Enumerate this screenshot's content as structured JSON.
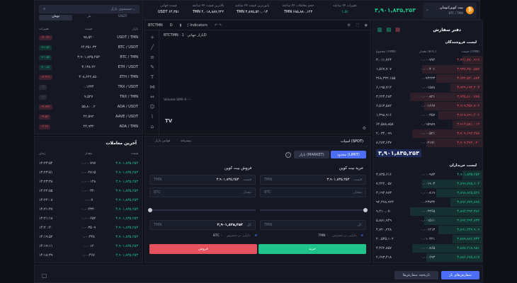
{
  "colors": {
    "green": "#1ec48b",
    "red": "#e8525e",
    "accent": "#4c6ef5",
    "orange": "#f7931a"
  },
  "market": {
    "pair_name": "بیت کوین/تومان",
    "pair_sub": "BTC / TMN",
    "last_price": "۳,۹۰۱,۸۳۵,۲۵۳",
    "change_label": "تغییرات ۲۴ ساعته",
    "change_value": "۱.۵٪",
    "high_label": "بالاترین قیمت ۲۴ ساعته",
    "high_value": "TMN ۴,۰۱۸,۸۸۷,۲۲۲",
    "low_label": "پایین‌ترین قیمت ۲۴ ساعته",
    "low_value": "TMN ۳,۸۷۵,۵۲۰,۰۱۴",
    "vol_label": "حجم معاملات ۲۴ ساعته",
    "vol_value": "TMN ۶۸۵,۸۸۰,۱۲۳",
    "usdt_label": "قیمت جهانی",
    "usdt_value": "USDT ۶۴,۳۵۱"
  },
  "search": {
    "placeholder": "جستجوی بازار..."
  },
  "market_tabs": [
    "تومان",
    "تتر",
    "USDT"
  ],
  "market_list": {
    "headers": [
      "تغییرات",
      "قیمت",
      "بازار"
    ],
    "rows": [
      {
        "change": "-۲.۰۴٪",
        "price": "۹۸,۵۲۰",
        "pair": "USDT / TMN",
        "dir": "down"
      },
      {
        "change": "+۱.۵٪",
        "price": "۶۴,۳۵۱.۳۳",
        "pair": "BTC / USDT",
        "dir": "up"
      },
      {
        "change": "+۱.۵٪",
        "price": "۳,۹۰۱,۸۳۵,۲۵۳",
        "pair": "BTC / TMN",
        "dir": "up"
      },
      {
        "change": "+۰.۸٪",
        "price": "۳,۱۳۸.۲۲",
        "pair": "ETH / USDT",
        "dir": "up"
      },
      {
        "change": "-۲.۹۱٪",
        "price": "۳۰۸,۶۲۲,۸۵۰",
        "pair": "ETH / TMN",
        "dir": "down"
      },
      {
        "change": "۰٪",
        "price": "۰.۱۲۳۴",
        "pair": "TRX / USDT",
        "dir": "flat"
      },
      {
        "change": "۰٪",
        "price": "۷,۵۲۷",
        "pair": "TRX / TMN",
        "dir": "flat"
      },
      {
        "change": "-۲.۸۹٪",
        "price": "۵۵,۸۰۰.۲",
        "pair": "ADA / USDT",
        "dir": "down"
      },
      {
        "change": "-۴.۵٪",
        "price": "۲۲,۵۹۲",
        "pair": "AAVE / USDT",
        "dir": "down"
      },
      {
        "change": "-۳.۳٪",
        "price": "۲۳,۹۳۲",
        "pair": "ADA / TMN",
        "dir": "down"
      }
    ]
  },
  "trades": {
    "title": "آخرین معاملات",
    "headers": [
      "زمان",
      "مقدار",
      "قیمت"
    ],
    "rows": [
      {
        "time": "۱۴:۲۳:۵۴",
        "amount": "۰.۰۰۰۷۹۷",
        "price": "۳,۹۰۱,۸۳۵,۲۵۳",
        "dir": "up"
      },
      {
        "time": "۱۴:۲۳:۵۱",
        "amount": "۰.۰۰۲۸۱۵",
        "price": "۳,۹۰۱,۸۳۵,۲۵۳",
        "dir": "up"
      },
      {
        "time": "۱۴:۲۳:۳۸",
        "amount": "۰.۰۰۰۱۴۸",
        "price": "۳,۹۰۱,۸۳۵,۲۵۳",
        "dir": "up"
      },
      {
        "time": "۱۴:۲۲:۵۵",
        "amount": "۰.۰۰۰۳۲۰",
        "price": "۳,۹۰۱,۸۳۵,۲۵۳",
        "dir": "up"
      },
      {
        "time": "۱۴:۲۲:۰۸",
        "amount": "۰.۰۰۷",
        "price": "۳,۹۰۱,۸۳۵,۲۵۳",
        "dir": "up"
      },
      {
        "time": "۱۴:۲۱:۴۷",
        "amount": "۰.۰۰۴۳۳۰",
        "price": "۳,۹۰۱,۸۳۵,۲۵۳",
        "dir": "up"
      },
      {
        "time": "۱۴:۲۱:۱۸",
        "amount": "۰.۰۰۰۶۵۲",
        "price": "۳,۹۰۱,۸۳۵,۲۵۳",
        "dir": "up"
      },
      {
        "time": "۱۴:۲۰:۴۰",
        "amount": "۰.۰۰۳۵۰۹",
        "price": "۳,۹۰۱,۸۳۵,۲۵۳",
        "dir": "up"
      },
      {
        "time": "۱۴:۱۹:۵۲",
        "amount": "۰.۰۰۴۴۸",
        "price": "۳,۹۰۱,۸۳۵,۲۵۳",
        "dir": "up"
      },
      {
        "time": "۱۴:۱۹:۱۱",
        "amount": "۰.۰۰۱۲",
        "price": "۳,۹۰۱,۸۳۵,۲۵۳",
        "dir": "up"
      },
      {
        "time": "۱۴:۱۸:۳۹",
        "amount": "۰.۰۰۴۶۷",
        "price": "۳,۹۰۱,۸۳۵,۲۵۳",
        "dir": "up"
      }
    ]
  },
  "chart_header": {
    "symbol": "BTCTMN",
    "interval": "D",
    "indicators": "Indicators",
    "title": "BTCTMN · بازار جهانی · 1D",
    "volume": "Volume  SMA 9  ---"
  },
  "order_tabs": {
    "spot": "اسپات (SPOT)",
    "tab1": "پیشرفته",
    "tab2": "قوانین بازار"
  },
  "order_types": {
    "limit": "محدود (LIMIT)",
    "market": "بازار (MARKET)"
  },
  "buy": {
    "title": "خرید بیت کوین",
    "price_label": "قیمت",
    "price_value": "۳,۹۰۱,۸۳۵,۲۵۳",
    "unit": "TMN",
    "amount_label": "مقدار",
    "amount_unit": "BTC",
    "total_label": "کل",
    "total_unit": "TMN",
    "balance_label": "دارایی در دسترس",
    "balance_value": "TMN ۰",
    "button": "خرید"
  },
  "sell": {
    "title": "فروش بیت کوین",
    "price_label": "قیمت",
    "price_value": "۳,۹۰۱,۸۳۵,۲۵۳",
    "unit": "TMN",
    "amount_label": "مقدار",
    "amount_unit": "BTC",
    "total_label": "کل",
    "total_value": "۳,۹۰۱,۸۳۵,۲۵۳",
    "total_unit": "TMN",
    "balance_label": "دارایی در دسترس",
    "balance_value": "BTC ۰",
    "button": "فروش"
  },
  "orderbook": {
    "title": "دفتر سفارش",
    "sell_title": "لیست فروشندگان",
    "buy_title": "لیست خریداران",
    "headers": [
      "مجموع (TMN)",
      "مقدار (BTC)",
      "قیمت (TMN)"
    ],
    "mid_price": "۳,۹۰۱,۸۳۵,۲۵۳",
    "asks": [
      {
        "total": "۳,۰۱۱,۷۶۴",
        "amount": "۰.۰۰۰۷۷۲",
        "price": "۳,۹۶۱,۷۸۰,۹۱۹"
      },
      {
        "total": "۱,۵۶۷,۷۰۷",
        "amount": "۰.۰۰۰۴۰۱",
        "price": "۳,۹۳۸,۲۵۰,۵۸۷"
      },
      {
        "total": "۳۶۸,۳۲۲,۱۵۵",
        "amount": "۰.۰۹۴۲۲۳",
        "price": "۳,۹۳۲,۵۳۰,۸۹۳"
      },
      {
        "total": "۶,۱۹۵,۷۱۲",
        "amount": "۰.۰۰۱۵۸۸",
        "price": "۳,۹۲۹,۱۹۴,۲۰۳"
      },
      {
        "total": "۳,۲۲۴,۲۸۳",
        "amount": "۰.۰۰۰۸۲۱",
        "price": "۳,۹۲۵,۸۱۰,۷۷۵"
      },
      {
        "total": "۶,۵۱۳,۵۸۲",
        "amount": "۰.۰۰۱۶۶۷",
        "price": "۳,۹۱۹,۳۵۶,۷۰۴"
      },
      {
        "total": "۱,۳۹۸,۹۱۶",
        "amount": "۰.۰۰۰۳۵۷",
        "price": "۳,۹۱۷,۸۹۱,۴۰۲"
      },
      {
        "total": "۶۲,۵۸۸,۸۵۸",
        "amount": "۰.۰۱۵۹۸۹",
        "price": "۳,۹۱۴,۵۸۱,۰۱۳"
      },
      {
        "total": "۲,۰۳۴,۰۹۹",
        "amount": "۰.۰۰۰۵۲۱",
        "price": "۳,۹۰۹,۶۹۲,۳۸۸"
      },
      {
        "total": "۸,۴۸۳,۶۳۷",
        "amount": "۰.۰۰۲۱۷۱",
        "price": "۳,۹۰۷,۳۷۲,۰۲۰"
      }
    ],
    "bids": [
      {
        "total": "۳,۸۳۵,۶۱۶",
        "amount": "۰.۰۰۰۹۸۳",
        "price": "۳,۹۰۱,۸۳۵,۲۵۳"
      },
      {
        "total": "۷,۴۲۲,۰۵۷",
        "amount": "۰.۰۰۱۹۰۳",
        "price": "۳,۸۹۹,۷۷۵,۶۰۴"
      },
      {
        "total": "۳,۱۹۴,۹۷۳",
        "amount": "۰.۰۰۰۸۱۹",
        "price": "۳,۸۹۸,۸۲۵,۵۲۶"
      },
      {
        "total": "۹۲,۴۷۸,۹۲۳",
        "amount": "۰.۰۲۳۷۳۲",
        "price": "۳,۸۹۶,۷۷۹,۸۹۸"
      },
      {
        "total": "۹,۲۱۰,۰۷۰",
        "amount": "۰.۰۰۲۳۶۵",
        "price": "۳,۸۹۴,۳۹۲,۳۸۶"
      },
      {
        "total": "۵,۸۸۱,۹۴۹",
        "amount": "۰.۰۰۱۵۱۱",
        "price": "۳,۸۹۲,۴۹۴,۸۳۳"
      },
      {
        "total": "۴,۷۲۰,۲۲۸",
        "amount": "۰.۰۰۱۲۱۳",
        "price": "۳,۸۹۱,۲۴۷,۹۰۹"
      },
      {
        "total": "۴۰,۵۳۵,۱۰۲",
        "amount": "۰.۰۱۰۴۲۱",
        "price": "۳,۸۸۹,۸۸۶,۷۳۴"
      },
      {
        "total": "۳,۳۶۲,۸۵۷",
        "amount": "۰.۰۰۰۸۶۵",
        "price": "۳,۸۸۷,۲۱۸,۹۸۱"
      },
      {
        "total": "۲,۶۹۳,۴۱۸",
        "amount": "۰.۰۰۰۶۹۳",
        "price": "۳,۸۸۶,۶۷۵,۸۱۷"
      }
    ]
  },
  "bottom": {
    "open_orders": "سفارش‌های باز",
    "history": "تاریخچه سفارش‌ها"
  }
}
